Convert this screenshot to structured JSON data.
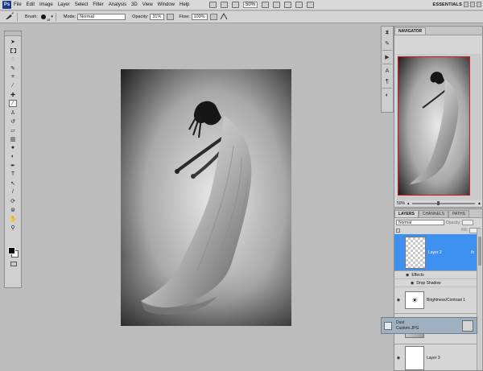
{
  "menubar": {
    "logo": "Ps",
    "items": [
      "File",
      "Edit",
      "Image",
      "Layer",
      "Select",
      "Filter",
      "Analysis",
      "3D",
      "View",
      "Window",
      "Help"
    ],
    "zoom": "50%",
    "workspace": "ESSENTIALS"
  },
  "options": {
    "brush_label": "Brush:",
    "brush_size": "18",
    "mode_label": "Mode:",
    "mode_value": "Normal",
    "opacity_label": "Opacity:",
    "opacity_value": "31%",
    "flow_label": "Flow:",
    "flow_value": "100%"
  },
  "tools": [
    "move-icon",
    "marquee-icon",
    "lasso-icon",
    "quick-select-icon",
    "crop-icon",
    "eyedropper-icon",
    "healing-icon",
    "brush-icon",
    "clone-stamp-icon",
    "history-brush-icon",
    "eraser-icon",
    "gradient-icon",
    "blur-icon",
    "dodge-icon",
    "pen-icon",
    "type-icon",
    "path-select-icon",
    "shape-icon",
    "rotate-3d-icon",
    "orbit-3d-icon",
    "hand-icon",
    "zoom-icon"
  ],
  "navigator": {
    "tab": "NAVIGATOR",
    "zoom": "50%"
  },
  "layers": {
    "tabs": [
      "LAYERS",
      "CHANNELS",
      "PATHS"
    ],
    "blend_mode": "Normal",
    "opacity_label": "Opacity:",
    "fill_label": "Fill:",
    "items": [
      {
        "name": "Layer 2",
        "fx": "fx"
      },
      {
        "name": "Effects"
      },
      {
        "name": "Drop Shadow"
      },
      {
        "name": "Brightness/Contrast 1"
      },
      {
        "name": "Layer 3"
      }
    ]
  },
  "drag_tooltip": {
    "line1": "Dust",
    "line2": "Custom.JPG"
  },
  "colors": {
    "selection_blue": "#3d8ff0",
    "nav_red": "#d21b1b"
  }
}
